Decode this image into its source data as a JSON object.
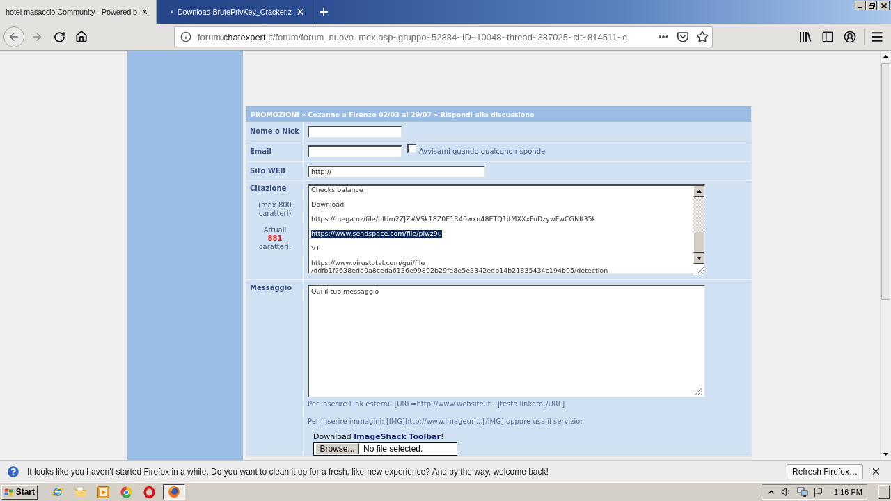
{
  "browser": {
    "tabs": [
      {
        "title": "hotel masaccio Community - Powered b",
        "selected": true
      },
      {
        "title": "Download BrutePrivKey_Cracker.z",
        "selected": false
      }
    ],
    "address": {
      "subdomain": "forum.",
      "domain": "chatexpert.it",
      "path": "/forum/forum_nuovo_mex.asp~gruppo~52884~ID~10048~thread~387025~cit~814511~c"
    }
  },
  "form": {
    "breadcrumb": "PROMOZIONI » Cezanne a Firenze 02/03 al 29/07 » Rispondi alla discussione",
    "rows": [
      {
        "kind": "text",
        "label": "Nome o Nick"
      },
      {
        "kind": "text_with_checkbox",
        "label": "Email",
        "checkbox": {
          "label": "Avvisami quando qualcuno risponde",
          "checked": false
        }
      },
      {
        "kind": "url",
        "label": "Sito WEB",
        "value": "http://"
      },
      {
        "kind": "quote",
        "label": "Citazione",
        "limit_note": "(max 800 caratteri)",
        "counter": {
          "label": "Attuali",
          "value": "881",
          "unit": "caratteri."
        },
        "paragraphs": [
          {
            "lines": [
              "Checks balance"
            ],
            "highlighted": false
          },
          {
            "lines": [
              "Download"
            ],
            "highlighted": false
          },
          {
            "lines": [
              "https://mega.nz/file/hlUm2ZJZ#VSk18Z0E1R46wxq48ETQ1itMXXxFuDzywFwCGNlt35k"
            ],
            "highlighted": false
          },
          {
            "lines": [
              "https://www.sendspace.com/file/plwz9u"
            ],
            "highlighted": true
          },
          {
            "lines": [
              "VT"
            ],
            "highlighted": false
          },
          {
            "lines": [
              "https://www.virustotal.com/gui/file",
              "/ddfb1f2638ede0a8ceda6136e99802b29fe8e5e3342edb14b21835434c194b95/detection"
            ],
            "highlighted": false
          }
        ]
      },
      {
        "kind": "message",
        "label": "Messaggio",
        "value": "Qui il tuo messaggio",
        "hints": [
          "Per inserire Link esterni: [URL=http://www.website.it...]testo linkato[/URL]",
          "Per inserire immagini: [IMG]http://www.imageurl...[/IMG] oppure usa il servizio:"
        ],
        "upload": {
          "before": "Download",
          "link": "ImageShack Toolbar",
          "after": "!",
          "button": "Browse...",
          "status": "No file selected."
        }
      }
    ]
  },
  "notification": {
    "message": "It looks like you haven’t started Firefox in a while. Do you want to clean it up for a fresh, like-new experience? And by the way, welcome back!",
    "button": "Refresh Firefox…"
  },
  "taskbar": {
    "start": "Start",
    "window_buttons": [
      {
        "selected": true
      }
    ],
    "clock": "1:16 PM"
  }
}
